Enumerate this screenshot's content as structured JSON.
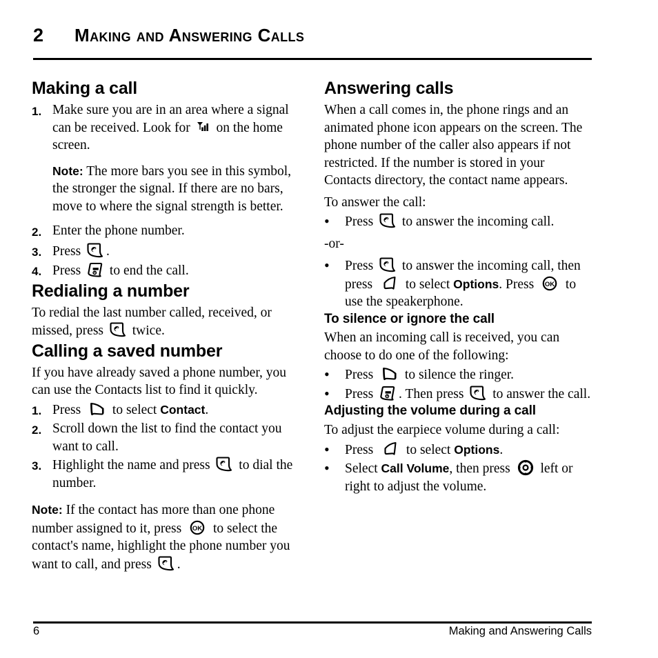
{
  "header": {
    "chapter_number": "2",
    "chapter_title": "Making and Answering Calls"
  },
  "footer": {
    "page_number": "6",
    "running_title": "Making and Answering Calls"
  },
  "left_column": {
    "section1": {
      "heading": "Making a call",
      "items": [
        {
          "marker": "1.",
          "text_before_icon": "Make sure you are in an area where a signal can be received. Look for ",
          "icon": "signal-strength-icon",
          "text_after_icon": " on the home screen."
        },
        {
          "marker": "2.",
          "text_before_icon": "Enter the phone number.",
          "icon": "",
          "text_after_icon": ""
        },
        {
          "marker": "3.",
          "text_before_icon": "Press ",
          "icon": "send-key-icon",
          "text_after_icon": "."
        },
        {
          "marker": "4.",
          "text_before_icon": "Press ",
          "icon": "end-key-icon",
          "text_after_icon": " to end the call."
        }
      ],
      "note_label": "Note:",
      "note_text": "The more bars you see in this symbol, the stronger the signal. If there are no bars, move to where the signal strength is better."
    },
    "section2": {
      "heading": "Redialing a number",
      "text_before_icon": "To redial the last number called, received, or missed, press ",
      "icon": "send-key-icon",
      "text_after_icon": " twice."
    },
    "section3": {
      "heading": "Calling a saved number",
      "intro": "If you have already saved a phone number, you can use the Contacts list to find it quickly.",
      "items": [
        {
          "marker": "1.",
          "text_before_icon": "Press ",
          "icon": "right-soft-key-icon",
          "text_after_icon": " to select ",
          "bold_term": "Contact",
          "text_end": "."
        },
        {
          "marker": "2.",
          "text_before_icon": "Scroll down the list to find the contact you want to call.",
          "icon": "",
          "text_after_icon": "",
          "bold_term": "",
          "text_end": ""
        },
        {
          "marker": "3.",
          "text_before_icon": "Highlight the name and press ",
          "icon": "send-key-icon",
          "text_after_icon": " to dial the number.",
          "bold_term": "",
          "text_end": ""
        }
      ],
      "note_label": "Note:",
      "note_part1": "If the contact has more than one phone number assigned to it, press ",
      "note_icon1": "ok-key-icon",
      "note_part2": " to select the contact's name, highlight the phone number you want to call, and press ",
      "note_icon2": "send-key-icon",
      "note_part3": "."
    }
  },
  "right_column": {
    "section1": {
      "heading": "Answering calls",
      "intro": "When a call comes in, the phone rings and an animated phone icon appears on the screen. The phone number of the caller also appears if not restricted. If the number is stored in your Contacts directory, the contact name appears.",
      "lead_in": "To answer the call:",
      "bullet1": {
        "marker": "•",
        "text_before_icon": "Press ",
        "icon": "send-key-icon",
        "text_after_icon": " to answer the incoming call."
      },
      "or_separator": "-or-",
      "bullet2": {
        "marker": "•",
        "part1": "Press ",
        "icon1": "send-key-icon",
        "part2": " to answer the incoming call, then press ",
        "icon2": "left-soft-key-icon",
        "part3": " to select ",
        "bold_term": "Options",
        "part4": ". Press ",
        "icon3": "ok-key-icon",
        "part5": " to use the speakerphone."
      }
    },
    "section2": {
      "heading": "To silence or ignore the call",
      "intro": "When an incoming call is received, you can choose to do one of the following:",
      "bullet1": {
        "marker": "•",
        "text_before_icon": "Press ",
        "icon": "right-soft-key-icon",
        "text_after_icon": " to silence the ringer."
      },
      "bullet2": {
        "marker": "•",
        "part1": "Press ",
        "icon1": "end-key-icon",
        "part2": ". Then press ",
        "icon2": "send-key-icon",
        "part3": " to answer the call."
      }
    },
    "section3": {
      "heading": "Adjusting the volume during a call",
      "intro": "To adjust the earpiece volume during a call:",
      "bullet1": {
        "marker": "•",
        "text_before_icon": "Press ",
        "icon": "left-soft-key-icon",
        "text_after_icon": " to select ",
        "bold_term": "Options",
        "text_end": "."
      },
      "bullet2": {
        "marker": "•",
        "part1": "Select ",
        "bold_term": "Call Volume",
        "part2": ", then press ",
        "icon": "navigation-key-icon",
        "part3": " left or right to adjust the volume."
      }
    }
  },
  "colors": {
    "text": "#000000",
    "background": "#ffffff",
    "rule": "#000000"
  }
}
